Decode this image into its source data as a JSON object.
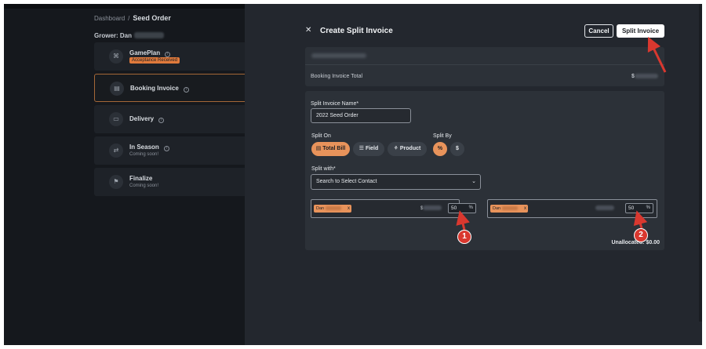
{
  "breadcrumb": {
    "home": "Dashboard",
    "separator": "/",
    "current": "Seed Order"
  },
  "grower": {
    "label": "Grower: Dan"
  },
  "steps": [
    {
      "label": "GamePlan",
      "badge": "Acceptance Received",
      "icon": "gameplan-icon"
    },
    {
      "label": "Booking Invoice",
      "icon": "invoice-icon",
      "active": true
    },
    {
      "label": "Delivery",
      "icon": "truck-icon"
    },
    {
      "label": "In Season",
      "sub": "Coming soon!",
      "icon": "cycle-icon"
    },
    {
      "label": "Finalize",
      "sub": "Coming soon!",
      "icon": "flag-icon"
    }
  ],
  "panel": {
    "title": "Create Split Invoice",
    "close_glyph": "✕",
    "cancel_label": "Cancel",
    "split_label": "Split Invoice"
  },
  "booking": {
    "total_label": "Booking Invoice Total",
    "currency": "$"
  },
  "form": {
    "name_label": "Split Invoice Name*",
    "name_value": "2022 Seed Order",
    "split_on_label": "Split On",
    "split_on_options": [
      "Total Bill",
      "Field",
      "Product"
    ],
    "split_on_selected": "Total Bill",
    "split_by_label": "Split By",
    "split_by_options": [
      "%",
      "$"
    ],
    "split_by_selected": "%",
    "split_with_label": "Split with*",
    "contact_placeholder": "Search to Select Contact"
  },
  "splits": [
    {
      "contact": "Dan",
      "remove": "x",
      "currency": "$",
      "percent": "50",
      "unit": "%",
      "marker": "1"
    },
    {
      "contact": "Dan",
      "remove": "x",
      "currency": "",
      "percent": "50",
      "unit": "%",
      "marker": "2"
    }
  ],
  "unallocated": {
    "label": "Unallocated:",
    "value": "$0.00"
  },
  "colors": {
    "accent": "#e8935b",
    "annotation": "#d9382f",
    "panel": "#23272e"
  }
}
